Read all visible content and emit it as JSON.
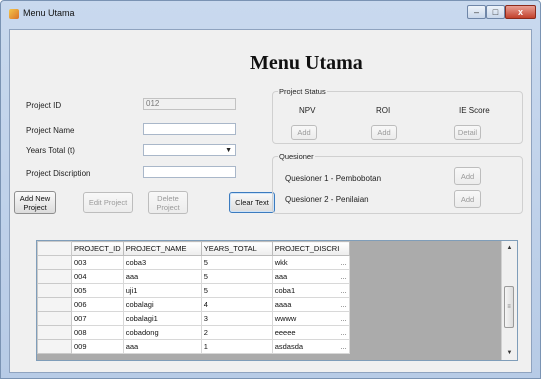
{
  "window": {
    "title": "Menu Utama",
    "controls": {
      "minimize": "–",
      "maximize": "□",
      "close": "x"
    }
  },
  "heading": "Menu Utama",
  "form": {
    "project_id": {
      "label": "Project ID",
      "value": "012"
    },
    "project_name": {
      "label": "Project Name",
      "value": ""
    },
    "years_total": {
      "label": "Years Total (t)",
      "value": ""
    },
    "project_description": {
      "label": "Project Discription",
      "value": ""
    }
  },
  "buttons": {
    "add_new_project": "Add New Project",
    "edit_project": "Edit Project",
    "delete_project": "Delete Project",
    "clear_text": "Clear Text"
  },
  "project_status": {
    "caption": "Project Status",
    "columns": [
      {
        "label": "NPV",
        "button": "Add"
      },
      {
        "label": "ROI",
        "button": "Add"
      },
      {
        "label": "IE Score",
        "button": "Detail"
      }
    ]
  },
  "questioner": {
    "caption": "Quesioner",
    "rows": [
      {
        "label": "Quesioner 1 - Pembobotan",
        "button": "Add"
      },
      {
        "label": "Quesioner 2 - Penilaian",
        "button": "Add"
      }
    ]
  },
  "grid": {
    "columns": [
      "PROJECT_ID",
      "PROJECT_NAME",
      "YEARS_TOTAL",
      "PROJECT_DISCRI"
    ],
    "rows": [
      [
        "003",
        "coba3",
        "5",
        "wkk"
      ],
      [
        "004",
        "aaa",
        "5",
        "aaa"
      ],
      [
        "005",
        "uji1",
        "5",
        "coba1"
      ],
      [
        "006",
        "cobalagi",
        "4",
        "aaaa"
      ],
      [
        "007",
        "cobalagi1",
        "3",
        "wwww"
      ],
      [
        "008",
        "cobadong",
        "2",
        "eeeee"
      ],
      [
        "009",
        "aaa",
        "1",
        "asdasda"
      ]
    ],
    "cell_ellipsis": "..."
  }
}
